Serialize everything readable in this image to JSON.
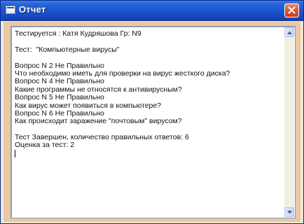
{
  "window": {
    "title": "Отчет",
    "icon": "window-app-icon"
  },
  "title_bar": {
    "close_icon": "close-icon"
  },
  "report": {
    "lines": [
      "Тестируется : Катя Кудряшова Гр: N9",
      "",
      "Тест:  \"Компьютерные вирусы\"",
      "",
      "Вопрос N 2 Не Правильно",
      "Что необходимо иметь для проверки на вирус жесткого диска?",
      "Вопрос N 4 Не Правильно",
      "Какие программы не относятся к антивирусным?",
      "Вопрос N 5 Не Правильно",
      "Как вирус может появиться в компьютере?",
      "Вопрос N 6 Не Правильно",
      "Как происходит заражение \"почтовым\" вирусом?",
      "",
      "Тест Завершен, количество правильных ответов: 6",
      "Оценка за тест: 2"
    ]
  },
  "scrollbar": {
    "up_icon": "scroll-up-arrow-icon",
    "down_icon": "scroll-down-arrow-icon"
  }
}
